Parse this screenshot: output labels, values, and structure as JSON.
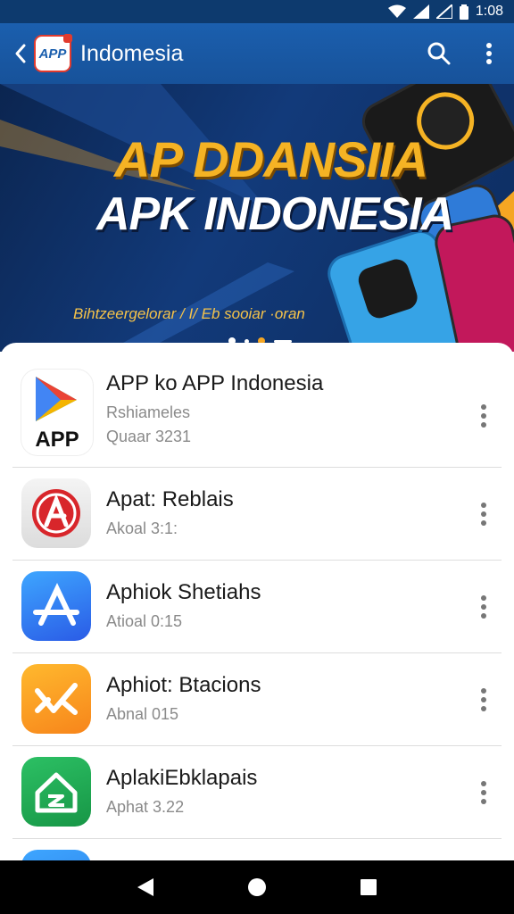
{
  "status_bar": {
    "time": "1:08"
  },
  "app_bar": {
    "logo_text": "APP",
    "title": "Indomesia"
  },
  "banner": {
    "title_line1": "AP DDANSIIA",
    "title_line2": "APK INDONESIA",
    "subtitle": "Bihtzeergelorar / I/ Eb sooiar ·oran"
  },
  "apps": [
    {
      "name": "APP ko APP Indonesia",
      "line1": "Rshiameles",
      "line2": "Quaar 3231",
      "icon": "play-triangle-icon",
      "color": "#ffffff"
    },
    {
      "name": "Apat: Reblais",
      "line1": "Akoal 3:1:",
      "icon": "red-a-icon",
      "color": "#d8262b"
    },
    {
      "name": "Aphiok Shetiahs",
      "line1": "Atioal 0:15",
      "icon": "blue-a-icon",
      "color": "#2f76f0"
    },
    {
      "name": "Aphiot: Btacions",
      "line1": "Abnal 015",
      "icon": "orange-x-icon",
      "color": "#f79c1b"
    },
    {
      "name": "AplakiEbklapais",
      "line1": "Aphat 3.22",
      "icon": "green-home-icon",
      "color": "#1fa653"
    }
  ],
  "colors": {
    "app_bar": "#1b5fae",
    "banner_accent": "#f5b324"
  }
}
